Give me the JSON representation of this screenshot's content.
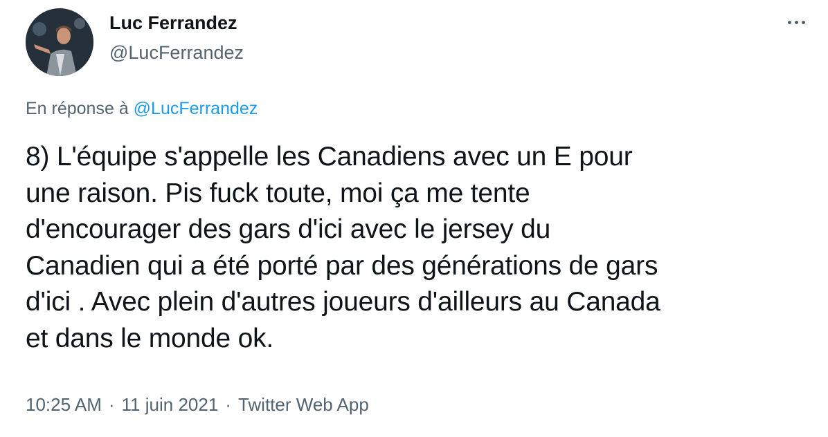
{
  "author": {
    "name": "Luc Ferrandez",
    "handle": "@LucFerrandez"
  },
  "reply": {
    "prefix": "En réponse à",
    "mention": "@LucFerrandez"
  },
  "tweet": {
    "text": "8) L'équipe s'appelle les Canadiens avec un E pour\nune raison. Pis fuck toute, moi ça me tente\nd'encourager des gars d'ici avec le jersey du\nCanadien qui a été porté par des générations de gars\nd'ici . Avec plein d'autres joueurs d'ailleurs au Canada\net dans le monde ok."
  },
  "meta": {
    "time": "10:25 AM",
    "separator": "·",
    "date": "11 juin 2021",
    "client": "Twitter Web App"
  },
  "icons": {
    "more": "more-options-icon"
  },
  "colors": {
    "text": "#0f1419",
    "secondary": "#536471",
    "link": "#1d9bf0",
    "background": "#ffffff"
  }
}
